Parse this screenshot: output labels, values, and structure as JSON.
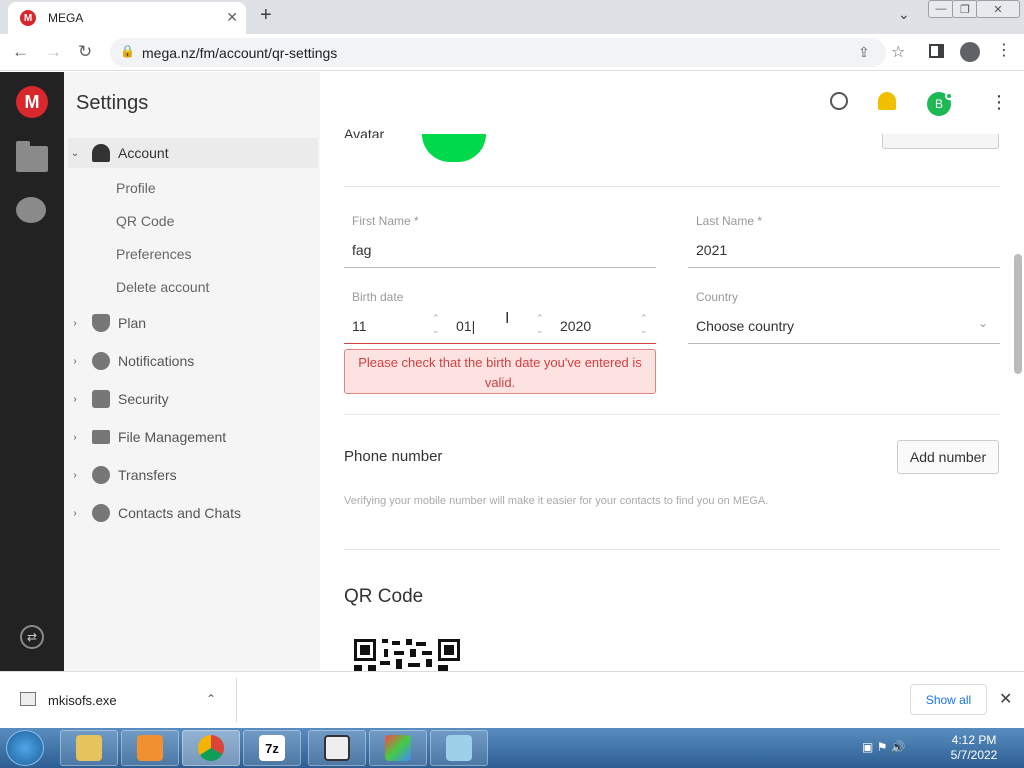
{
  "browser": {
    "tab_title": "MEGA",
    "tab_favicon": "M",
    "close_glyph": "✕",
    "new_tab_glyph": "+",
    "tab_menu_glyph": "⌄",
    "back_glyph": "←",
    "forward_glyph": "→",
    "reload_glyph": "↻",
    "url": "mega.nz/fm/account/qr-settings",
    "lock_glyph": "🔒",
    "share_glyph": "⇪",
    "star_glyph": "☆",
    "menu_glyph": "⋮",
    "win_min": "—",
    "win_restore": "❐",
    "win_close": "✕"
  },
  "sidebar": {
    "logo": "M",
    "sync_glyph": "⇄"
  },
  "settings_nav": {
    "title": "Settings",
    "account_label": "Account",
    "sub_items": [
      "Profile",
      "QR Code",
      "Preferences",
      "Delete account"
    ],
    "items": [
      "Plan",
      "Notifications",
      "Security",
      "File Management",
      "Transfers",
      "Contacts and Chats"
    ],
    "expanded_chevron": "⌄",
    "collapsed_chevron": "›"
  },
  "header": {
    "avatar_letter": "B",
    "menu_glyph": "⋮"
  },
  "profile": {
    "avatar_label": "Avatar",
    "first_name_label": "First Name *",
    "first_name_value": "fag",
    "last_name_label": "Last Name *",
    "last_name_value": "2021",
    "birth_date_label": "Birth date",
    "birth_day": "11",
    "birth_month": "01|",
    "birth_year": "2020",
    "spin_glyph": "⌃\n⌄",
    "country_label": "Country",
    "country_value": "Choose country",
    "country_chevron": "⌄",
    "error_text": "Please check that the birth date you've entered is valid."
  },
  "phone": {
    "title": "Phone number",
    "add_button": "Add number",
    "description": "Verifying your mobile number will make it easier for your contacts to find you on MEGA."
  },
  "qr": {
    "title": "QR Code"
  },
  "download_bar": {
    "file_name": "mkisofs.exe",
    "chevron": "⌃",
    "show_all": "Show all",
    "close_glyph": "✕"
  },
  "taskbar": {
    "seven_zip": "7z",
    "time": "4:12 PM",
    "date": "5/7/2022"
  }
}
